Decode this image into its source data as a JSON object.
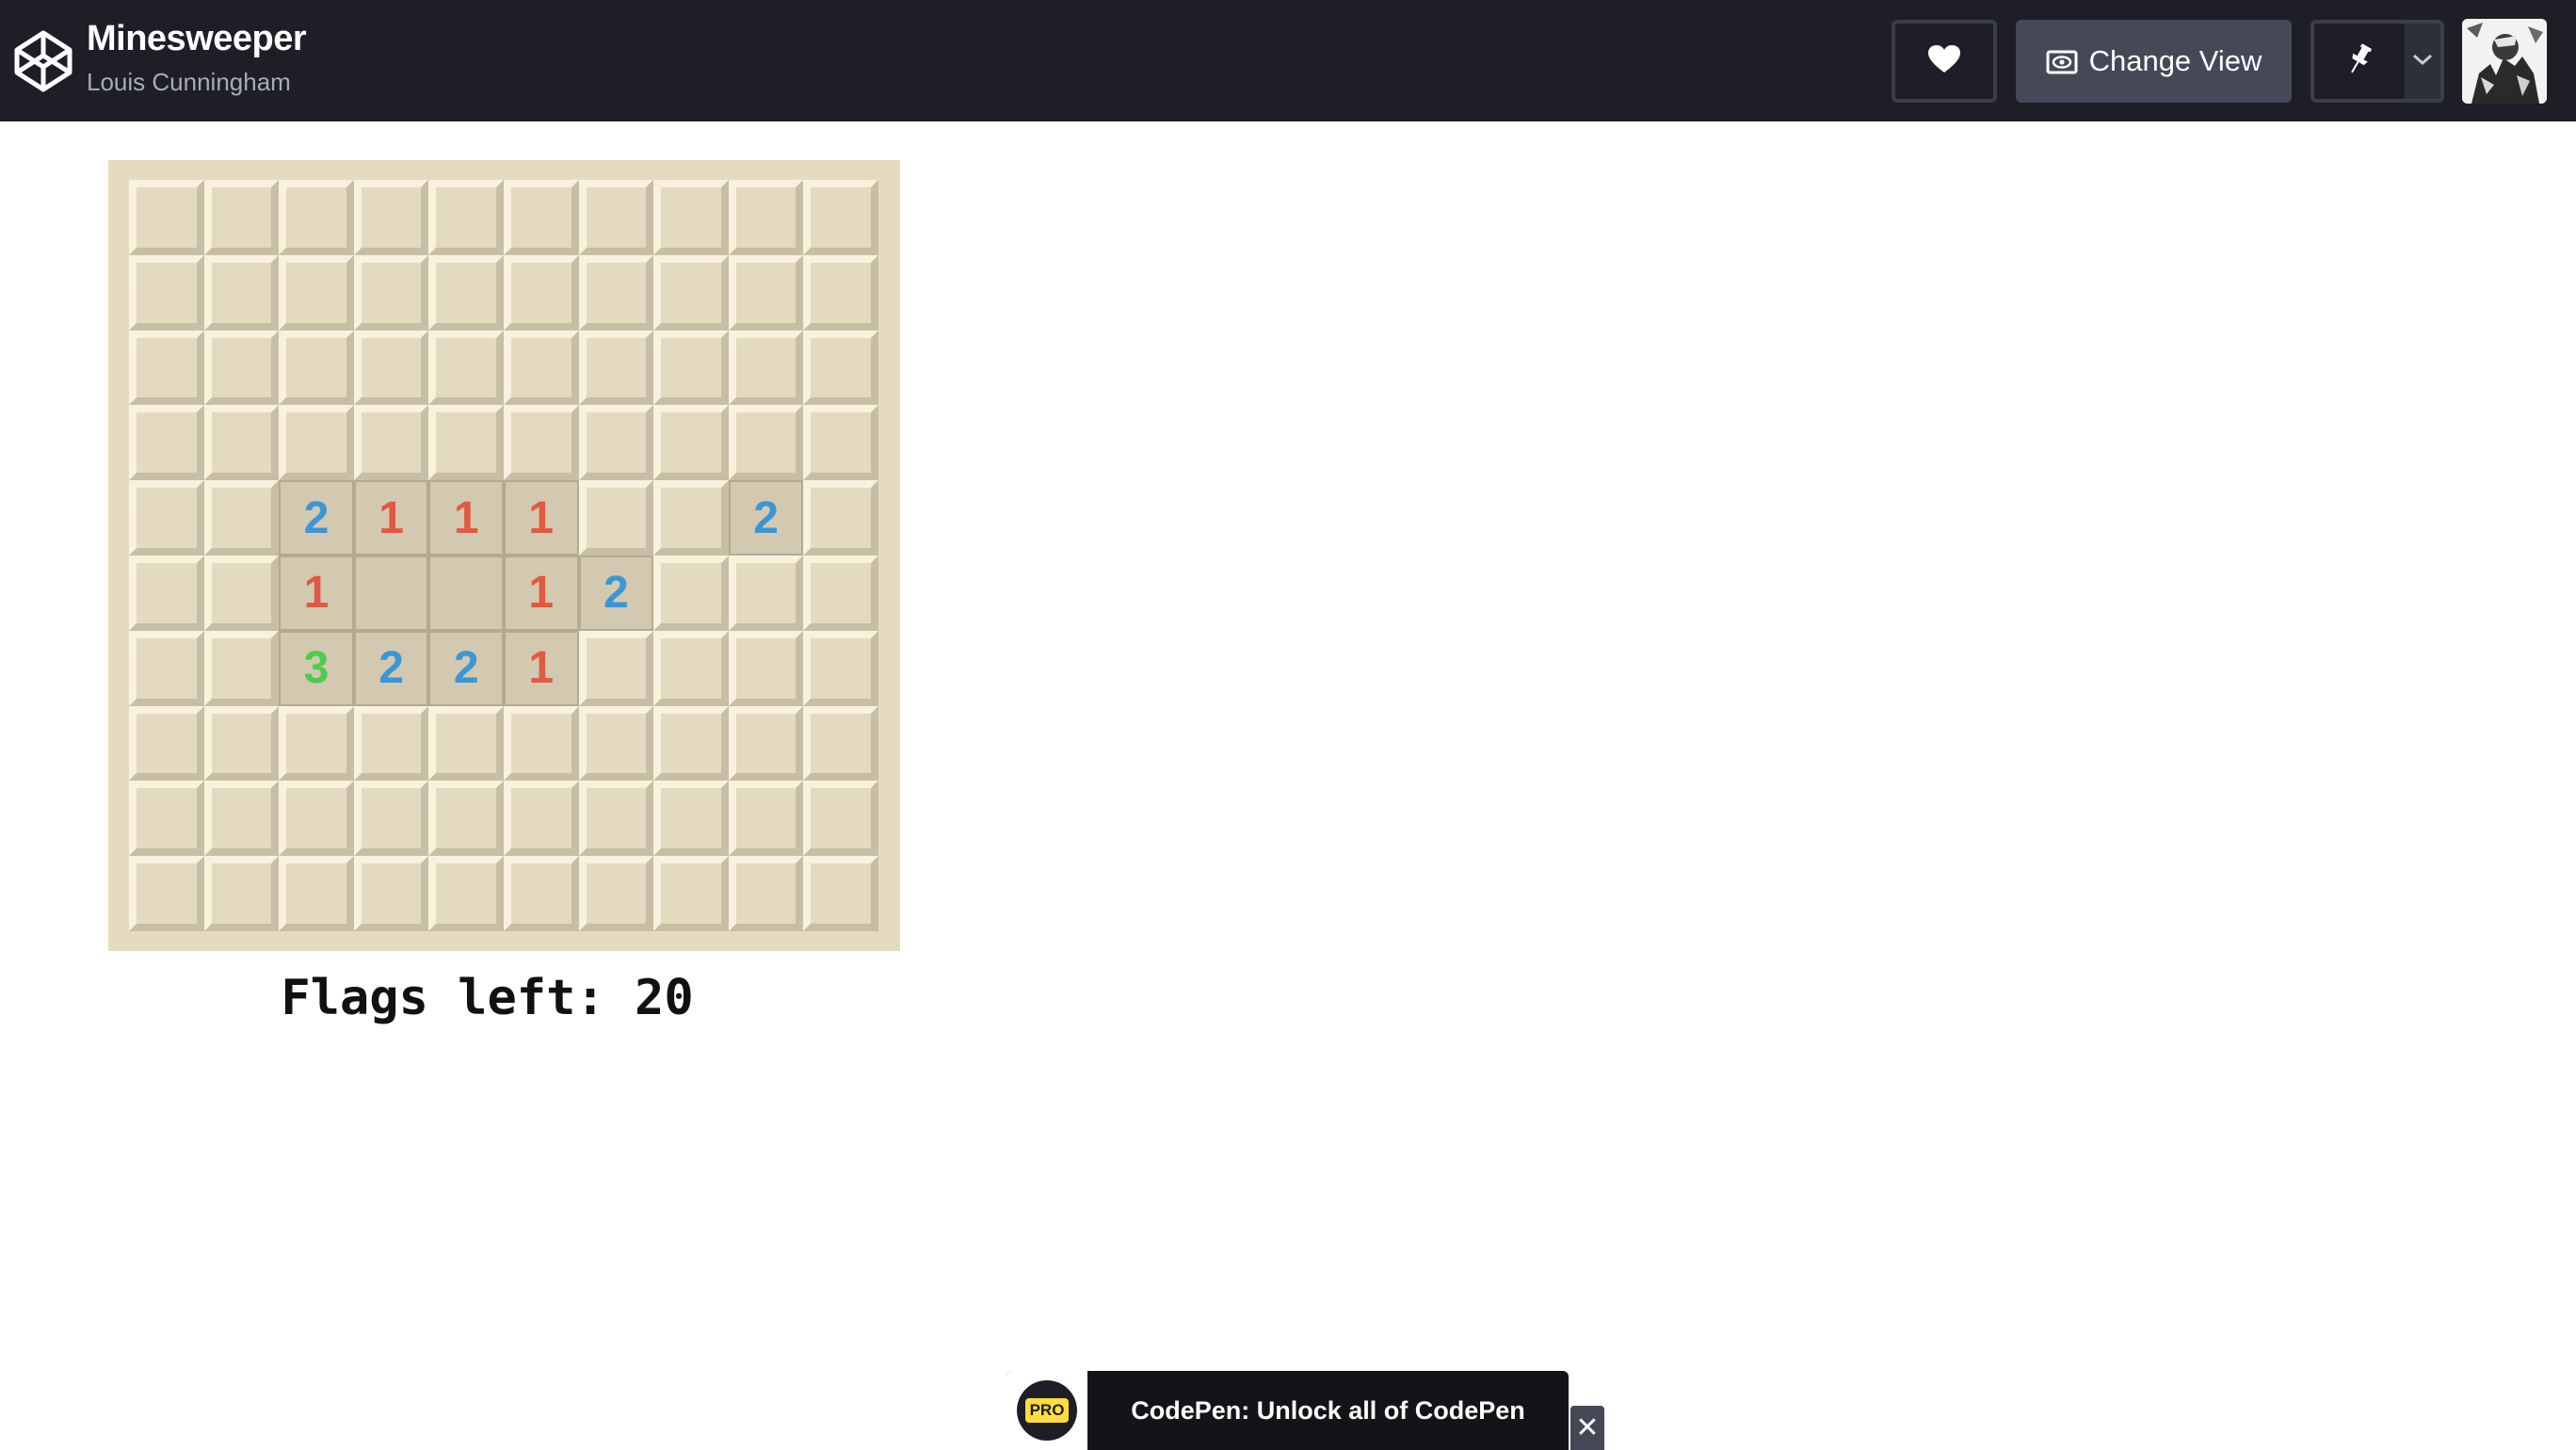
{
  "header": {
    "title": "Minesweeper",
    "author": "Louis Cunningham",
    "change_view_label": "Change View",
    "icons": {
      "logo": "codepen-logo-icon",
      "heart": "heart-icon",
      "view": "eye-icon",
      "pin": "pin-icon",
      "caret": "chevron-down-icon"
    }
  },
  "game": {
    "rows": 10,
    "cols": 10,
    "revealed_cells": [
      {
        "row": 4,
        "col": 2,
        "value": "2"
      },
      {
        "row": 4,
        "col": 3,
        "value": "1"
      },
      {
        "row": 4,
        "col": 4,
        "value": "1"
      },
      {
        "row": 4,
        "col": 5,
        "value": "1"
      },
      {
        "row": 4,
        "col": 8,
        "value": "2"
      },
      {
        "row": 5,
        "col": 2,
        "value": "1"
      },
      {
        "row": 5,
        "col": 3,
        "value": ""
      },
      {
        "row": 5,
        "col": 4,
        "value": ""
      },
      {
        "row": 5,
        "col": 5,
        "value": "1"
      },
      {
        "row": 5,
        "col": 6,
        "value": "2"
      },
      {
        "row": 6,
        "col": 2,
        "value": "3"
      },
      {
        "row": 6,
        "col": 3,
        "value": "2"
      },
      {
        "row": 6,
        "col": 4,
        "value": "2"
      },
      {
        "row": 6,
        "col": 5,
        "value": "1"
      }
    ],
    "number_colors": {
      "1": "#e05a43",
      "2": "#3c96d4",
      "3": "#4ccc4c"
    },
    "flags_text": "Flags left: 20"
  },
  "banner": {
    "badge": "PRO",
    "text": "CodePen: Unlock all of CodePen",
    "close_symbol": "✕"
  }
}
